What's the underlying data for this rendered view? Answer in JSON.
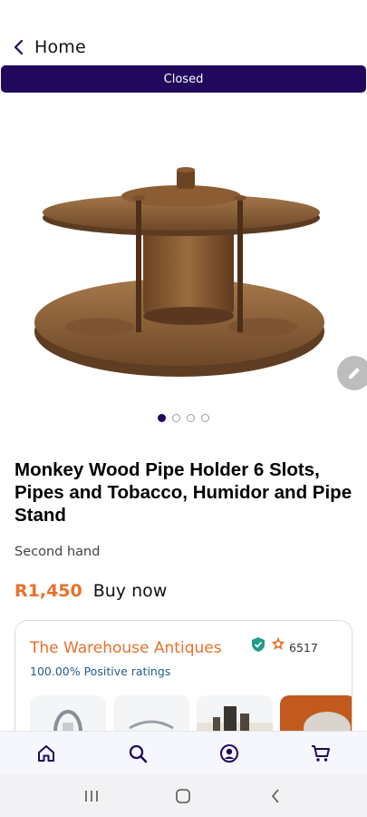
{
  "header": {
    "back_label": "Home",
    "back_icon": "chevron-left-icon"
  },
  "status_banner": {
    "text": "Closed"
  },
  "gallery": {
    "image_count": 4,
    "active_index": 0,
    "image_alt": "Monkey wood pipe holder"
  },
  "product": {
    "title": "Monkey Wood Pipe Holder 6 Slots, Pipes and Tobacco, Humidor and Pipe Stand",
    "condition": "Second hand",
    "price": "R1,450",
    "buy_label": "Buy now"
  },
  "seller": {
    "name": "The Warehouse Antiques",
    "rating_count": "6517",
    "positive_ratings": "100.00% Positive ratings",
    "verified_icon": "shield-check-icon",
    "star_icon": "star-badge-icon"
  },
  "bottom_nav": [
    {
      "name": "home",
      "icon": "home-icon"
    },
    {
      "name": "search",
      "icon": "search-icon"
    },
    {
      "name": "account",
      "icon": "user-icon"
    },
    {
      "name": "cart",
      "icon": "cart-icon"
    }
  ],
  "colors": {
    "brand": "#21085c",
    "accent": "#e8702a",
    "link": "#1f5d8a"
  }
}
